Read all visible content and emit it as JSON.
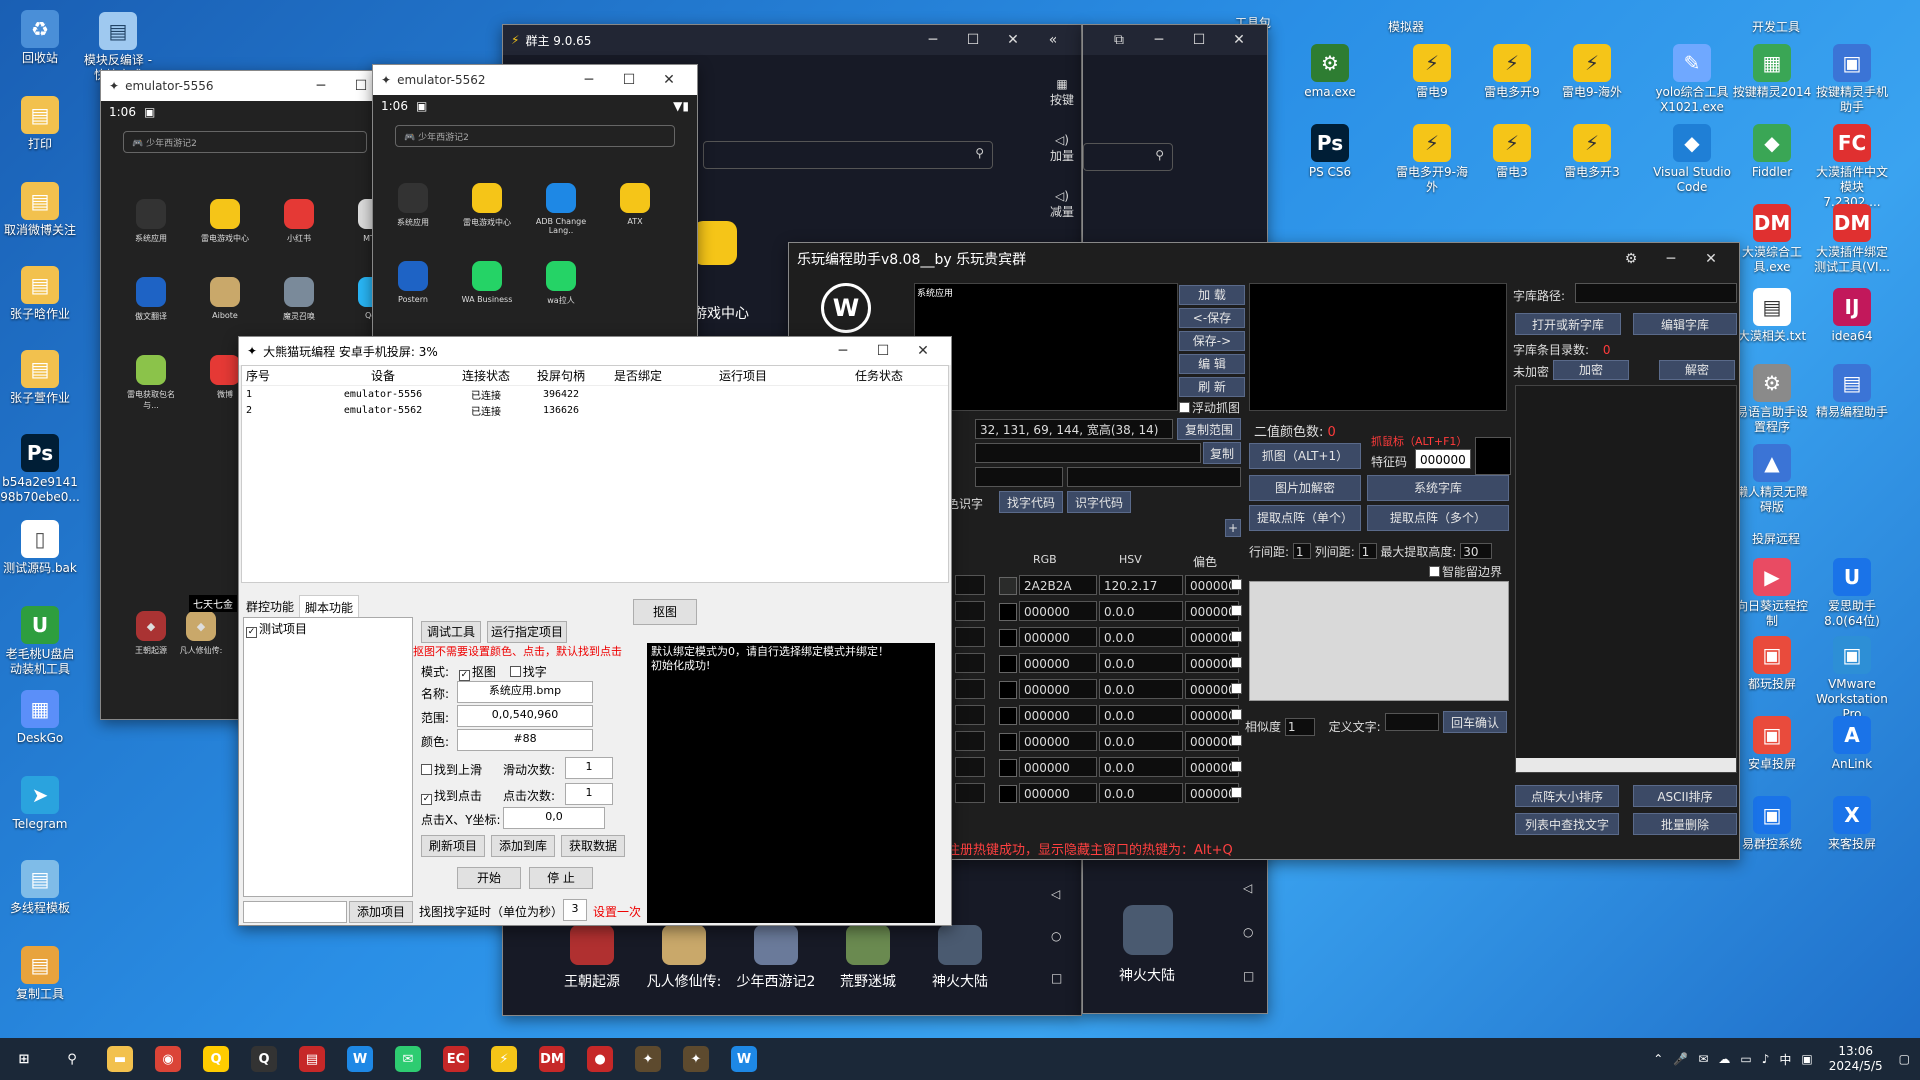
{
  "desktop": {
    "left_icons": [
      {
        "label": "回收站",
        "color": "#4a8fd8",
        "glyph": "♻"
      },
      {
        "label": "打印",
        "color": "#f2c14e",
        "glyph": "▤"
      },
      {
        "label": "取消微博关注",
        "color": "#f2c14e",
        "glyph": "▤"
      },
      {
        "label": "张子晗作业",
        "color": "#f2c14e",
        "glyph": "▤"
      },
      {
        "label": "张子萱作业",
        "color": "#f2c14e",
        "glyph": "▤"
      },
      {
        "label": "b54a2e9141 98b70ebe0...",
        "color": "#001e36",
        "glyph": "Ps"
      },
      {
        "label": "测试源码.bak",
        "color": "#ffffff",
        "glyph": "▯"
      },
      {
        "label": "老毛桃U盘启动装机工具",
        "color": "#2e9e3e",
        "glyph": "U"
      },
      {
        "label": "DeskGo",
        "color": "#5b8ff9",
        "glyph": "▦"
      },
      {
        "label": "Telegram",
        "color": "#2aa3de",
        "glyph": "➤"
      },
      {
        "label": "多线程模板",
        "color": "#7fbce8",
        "glyph": "▤"
      },
      {
        "label": "复制工具",
        "color": "#e8a33d",
        "glyph": "▤"
      }
    ],
    "top_icon": {
      "label": "模块反编译 - 快捷方式",
      "color": "#9fc9f0",
      "glyph": "▤"
    },
    "section_labels": {
      "emulator": "模拟器",
      "dev": "开发工具",
      "cast": "投屏远程",
      "tools": "工具包"
    },
    "right_icons": [
      {
        "label": "ema.exe",
        "color": "#2e7d32",
        "glyph": "⚙"
      },
      {
        "label": "雷电9",
        "color": "#f5c518",
        "glyph": "⚡"
      },
      {
        "label": "雷电多开9",
        "color": "#f5c518",
        "glyph": "⚡"
      },
      {
        "label": "雷电9-海外",
        "color": "#f5c518",
        "glyph": "⚡"
      },
      {
        "label": "yolo综合工具X1021.exe",
        "color": "#6fa8ff",
        "glyph": "✎"
      },
      {
        "label": "按键精灵2014",
        "color": "#3aa655",
        "glyph": "▦"
      },
      {
        "label": "按键精灵手机助手",
        "color": "#3b74d6",
        "glyph": "▣"
      },
      {
        "label": "PS CS6",
        "color": "#001e36",
        "glyph": "Ps"
      },
      {
        "label": "雷电多开9-海外",
        "color": "#f5c518",
        "glyph": "⚡"
      },
      {
        "label": "雷电3",
        "color": "#f5c518",
        "glyph": "⚡"
      },
      {
        "label": "雷电多开3",
        "color": "#f5c518",
        "glyph": "⚡"
      },
      {
        "label": "Visual Studio Code",
        "color": "#1f7fd6",
        "glyph": "◆"
      },
      {
        "label": "Fiddler",
        "color": "#3aa655",
        "glyph": "◆"
      },
      {
        "label": "大漠插件中文模块7.2302....",
        "color": "#e03030",
        "glyph": "FC"
      },
      {
        "label": "大漠综合工具.exe",
        "color": "#e03030",
        "glyph": "DM"
      },
      {
        "label": "大漠插件绑定测试工具(VI...",
        "color": "#e03030",
        "glyph": "DM"
      },
      {
        "label": "大漠相关.txt",
        "color": "#ffffff",
        "glyph": "▤"
      },
      {
        "label": "idea64",
        "color": "#c2185b",
        "glyph": "IJ"
      },
      {
        "label": "易语言助手设置程序",
        "color": "#8a8a8a",
        "glyph": "⚙"
      },
      {
        "label": "精易编程助手",
        "color": "#3b74d6",
        "glyph": "▤"
      },
      {
        "label": "懒人精灵无障碍版",
        "color": "#3b74d6",
        "glyph": "▲"
      },
      {
        "label": "向日葵远程控制",
        "color": "#e94b63",
        "glyph": "▶"
      },
      {
        "label": "爱思助手8.0(64位)",
        "color": "#1a73e8",
        "glyph": "U"
      },
      {
        "label": "都玩投屏",
        "color": "#e94b3c",
        "glyph": "▣"
      },
      {
        "label": "VMware Workstation Pro",
        "color": "#2d8fd6",
        "glyph": "▣"
      },
      {
        "label": "安卓投屏",
        "color": "#e94b3c",
        "glyph": "▣"
      },
      {
        "label": "AnLink",
        "color": "#1a73e8",
        "glyph": "A"
      },
      {
        "label": "易群控系统",
        "color": "#1a73e8",
        "glyph": "▣"
      },
      {
        "label": "来客投屏",
        "color": "#1a73e8",
        "glyph": "X"
      }
    ]
  },
  "emu5556": {
    "title": "emulator-5556",
    "time": "1:06",
    "search": "少年西游记2",
    "apps": [
      "系统应用",
      "雷电游戏中心",
      "小红书",
      "MT管",
      "傲文翻译",
      "Aibote",
      "魔灵召唤",
      "Qoo",
      "雷电获取包名与...",
      "微博"
    ],
    "dock": [
      "王朝起源",
      "凡人修仙传:"
    ],
    "banner": "七天七金"
  },
  "emu5562": {
    "title": "emulator-5562",
    "time": "1:06",
    "search": "少年西游记2",
    "apps": [
      "系统应用",
      "雷电游戏中心",
      "ADB Change Lang..",
      "ATX",
      "Postern",
      "WA Business",
      "wa拉人"
    ]
  },
  "qunzhu": {
    "title": "群主 9.0.65",
    "center_label": "游戏中心",
    "side_buttons": [
      "按键",
      "加量",
      "减量"
    ],
    "dock": [
      "王朝起源",
      "凡人修仙传:",
      "少年西游记2",
      "荒野迷城",
      "神火大陆"
    ],
    "dock2": "神火大陆"
  },
  "ctrl": {
    "title": "大熊猫玩编程 安卓手机投屏: 3%",
    "headers": [
      "序号",
      "设备",
      "连接状态",
      "投屏句柄",
      "是否绑定",
      "运行项目",
      "任务状态"
    ],
    "rows": [
      [
        "1",
        "emulator-5556",
        "已连接",
        "396422",
        "",
        "",
        ""
      ],
      [
        "2",
        "emulator-5562",
        "已连接",
        "136626",
        "",
        "",
        ""
      ]
    ],
    "tabs": [
      "群控功能",
      "脚本功能"
    ],
    "grab_button": "抠图",
    "project_item": "测试项目",
    "add_project": "添加项目",
    "debug_tool": "调试工具",
    "run_project": "运行指定项目",
    "hint": "抠图不需要设置颜色、点击，默认找到点击",
    "mode_label": "模式:",
    "mode_grab": "抠图",
    "mode_text": "找字",
    "name_label": "名称:",
    "name_value": "系统应用.bmp",
    "range_label": "范围:",
    "range_value": "0,0,540,960",
    "color_label": "颜色:",
    "color_value": "#88",
    "find_slide": "找到上滑",
    "slide_count_label": "滑动次数:",
    "slide_count": "1",
    "find_click": "找到点击",
    "click_count_label": "点击次数:",
    "click_count": "1",
    "xy_label": "点击X、Y坐标:",
    "xy_value": "0,0",
    "refresh_project": "刷新项目",
    "add_to_lib": "添加到库",
    "get_data": "获取数据",
    "start": "开始",
    "stop": "停 止",
    "delay_label": "找图找字延时（单位为秒）",
    "delay_value": "3",
    "set_once": "设置一次",
    "log_lines": [
      "默认绑定模式为0，请自行选择绑定模式并绑定！",
      "初始化成功!"
    ]
  },
  "lewan": {
    "title": "乐玩编程助手v8.08__by 乐玩贵宾群",
    "preview_label": "系统应用",
    "left_buttons": [
      "加 载",
      "<-保存",
      "保存->",
      "编 辑",
      "刷 新"
    ],
    "float_grab": "浮动抓图",
    "coords": "32, 131, 69, 144, 宽高(38, 14)",
    "copy_range": "复制范围",
    "copy": "复制",
    "color_text_label": "色识字",
    "find_code": "找字代码",
    "recognize_code": "识字代码",
    "col_rgb": "RGB",
    "col_hsv": "HSV",
    "col_offset": "偏色",
    "color_rows": [
      [
        "2A2B2A",
        "120.2.17",
        "000000",
        "#2a2b2a"
      ],
      [
        "000000",
        "0.0.0",
        "000000",
        "#000000"
      ],
      [
        "000000",
        "0.0.0",
        "000000",
        "#000000"
      ],
      [
        "000000",
        "0.0.0",
        "000000",
        "#000000"
      ],
      [
        "000000",
        "0.0.0",
        "000000",
        "#000000"
      ],
      [
        "000000",
        "0.0.0",
        "000000",
        "#000000"
      ],
      [
        "000000",
        "0.0.0",
        "000000",
        "#000000"
      ],
      [
        "000000",
        "0.0.0",
        "000000",
        "#000000"
      ],
      [
        "000000",
        "0.0.0",
        "000000",
        "#000000"
      ]
    ],
    "binary_count_label": "二值颜色数:",
    "binary_count": "0",
    "grab_hint": "抓鼠标（ALT+F1）",
    "feature_label": "特征码",
    "feature_value": "000000",
    "grab_alt": "抓图（ALT+1）",
    "img_decrypt": "图片加解密",
    "sys_lib": "系统字库",
    "extract_single": "提取点阵（单个）",
    "extract_multi": "提取点阵（多个）",
    "row_spacing_label": "行间距:",
    "row_spacing": "1",
    "col_spacing_label": "列间距:",
    "col_spacing": "1",
    "max_height_label": "最大提取高度:",
    "max_height": "30",
    "smart_edge": "智能留边界",
    "similarity_label": "相似度",
    "similarity": "1",
    "custom_text_label": "定义文字:",
    "enter_confirm": "回车确认",
    "status_msg": "注册热键成功，显示隐藏主窗口的热键为：Alt+Q",
    "lib_path_label": "字库路径:",
    "open_new_lib": "打开或新字库",
    "edit_lib": "编辑字库",
    "lib_count_label": "字库条目录数:",
    "lib_count": "0",
    "unencrypted": "未加密",
    "encrypt": "加密",
    "decrypt": "解密",
    "sort_size": "点阵大小排序",
    "sort_ascii": "ASCII排序",
    "find_in_list": "列表中查找文字",
    "batch_delete": "批量删除",
    "plus": "+"
  },
  "taskbar": {
    "time": "13:06",
    "date": "2024/5/5",
    "ime": "中",
    "apps": [
      {
        "name": "start",
        "glyph": "⊞",
        "color": "transparent"
      },
      {
        "name": "search",
        "glyph": "⚲",
        "color": "transparent"
      },
      {
        "name": "explorer",
        "glyph": "▬",
        "color": "#f2c14e"
      },
      {
        "name": "chrome",
        "glyph": "◉",
        "color": "#db4437"
      },
      {
        "name": "qq",
        "glyph": "Q",
        "color": "#ffcc00"
      },
      {
        "name": "qq2",
        "glyph": "Q",
        "color": "#333"
      },
      {
        "name": "app-red",
        "glyph": "▤",
        "color": "#c62828"
      },
      {
        "name": "lewan",
        "glyph": "W",
        "color": "#1e88e5"
      },
      {
        "name": "wechat",
        "glyph": "✉",
        "color": "#2ecc71"
      },
      {
        "name": "ec",
        "glyph": "EC",
        "color": "#c62828"
      },
      {
        "name": "ldplayer",
        "glyph": "⚡",
        "color": "#f5c518"
      },
      {
        "name": "dm",
        "glyph": "DM",
        "color": "#c62828"
      },
      {
        "name": "record",
        "glyph": "●",
        "color": "#c62828"
      },
      {
        "name": "panda1",
        "glyph": "✦",
        "color": "#5d4a2e"
      },
      {
        "name": "panda2",
        "glyph": "✦",
        "color": "#5d4a2e"
      },
      {
        "name": "lewan2",
        "glyph": "W",
        "color": "#1e88e5"
      }
    ]
  }
}
